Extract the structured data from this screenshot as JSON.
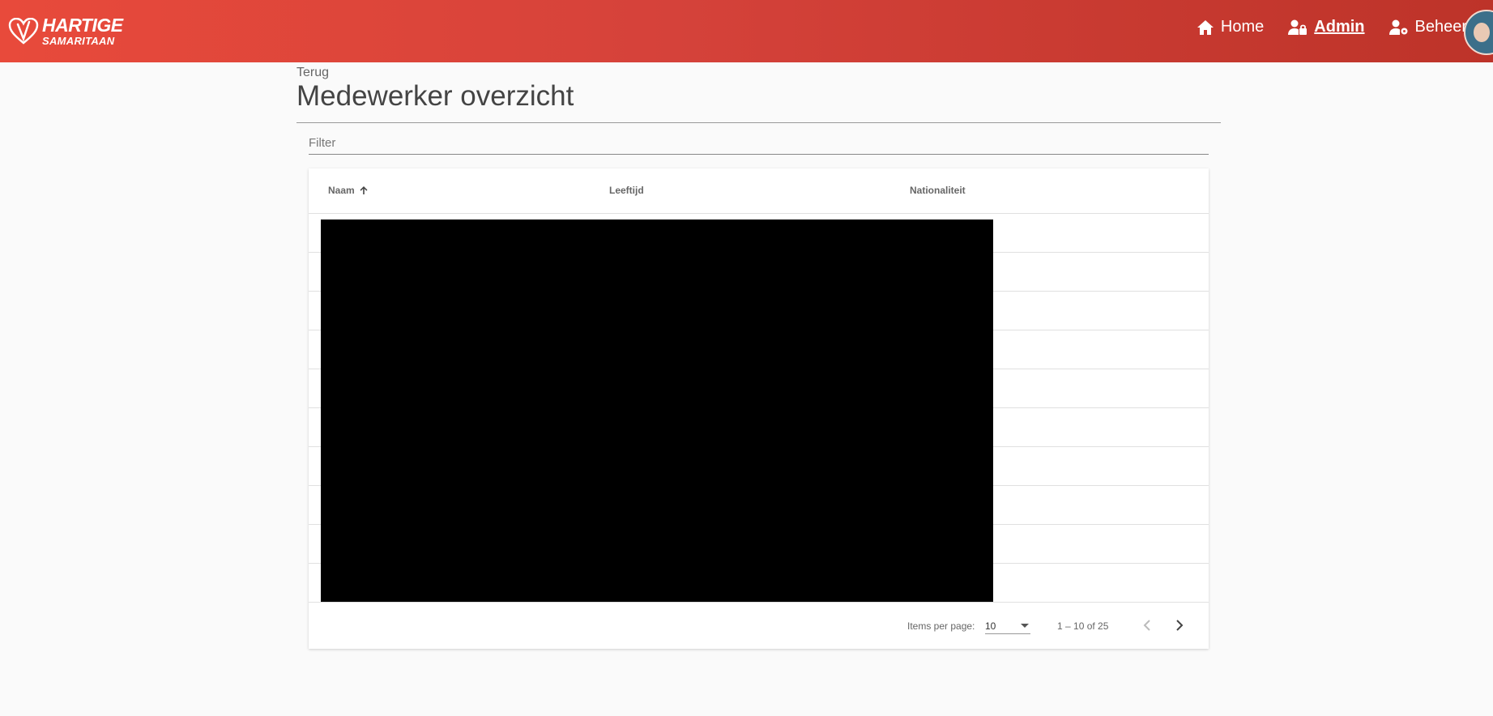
{
  "header": {
    "logo_line1": "HARTIGE",
    "logo_line2": "SAMARITAAN",
    "brand_color": "#d5423a",
    "nav": [
      {
        "label": "Home",
        "icon": "home-icon"
      },
      {
        "label": "Admin",
        "icon": "user-lock-icon",
        "active": true
      },
      {
        "label": "Beheer",
        "icon": "user-cog-icon"
      }
    ]
  },
  "page": {
    "back_label": "Terug",
    "title": "Medewerker overzicht"
  },
  "filter": {
    "placeholder": "Filter"
  },
  "table": {
    "columns": [
      {
        "label": "Naam",
        "sort": "asc"
      },
      {
        "label": "Leeftijd"
      },
      {
        "label": "Nationaliteit"
      }
    ],
    "rows": [
      {},
      {},
      {},
      {},
      {},
      {},
      {},
      {},
      {},
      {}
    ],
    "content_redacted": true
  },
  "paginator": {
    "items_per_page_label": "Items per page:",
    "items_per_page": "10",
    "range_label": "1 – 10 of 25"
  }
}
